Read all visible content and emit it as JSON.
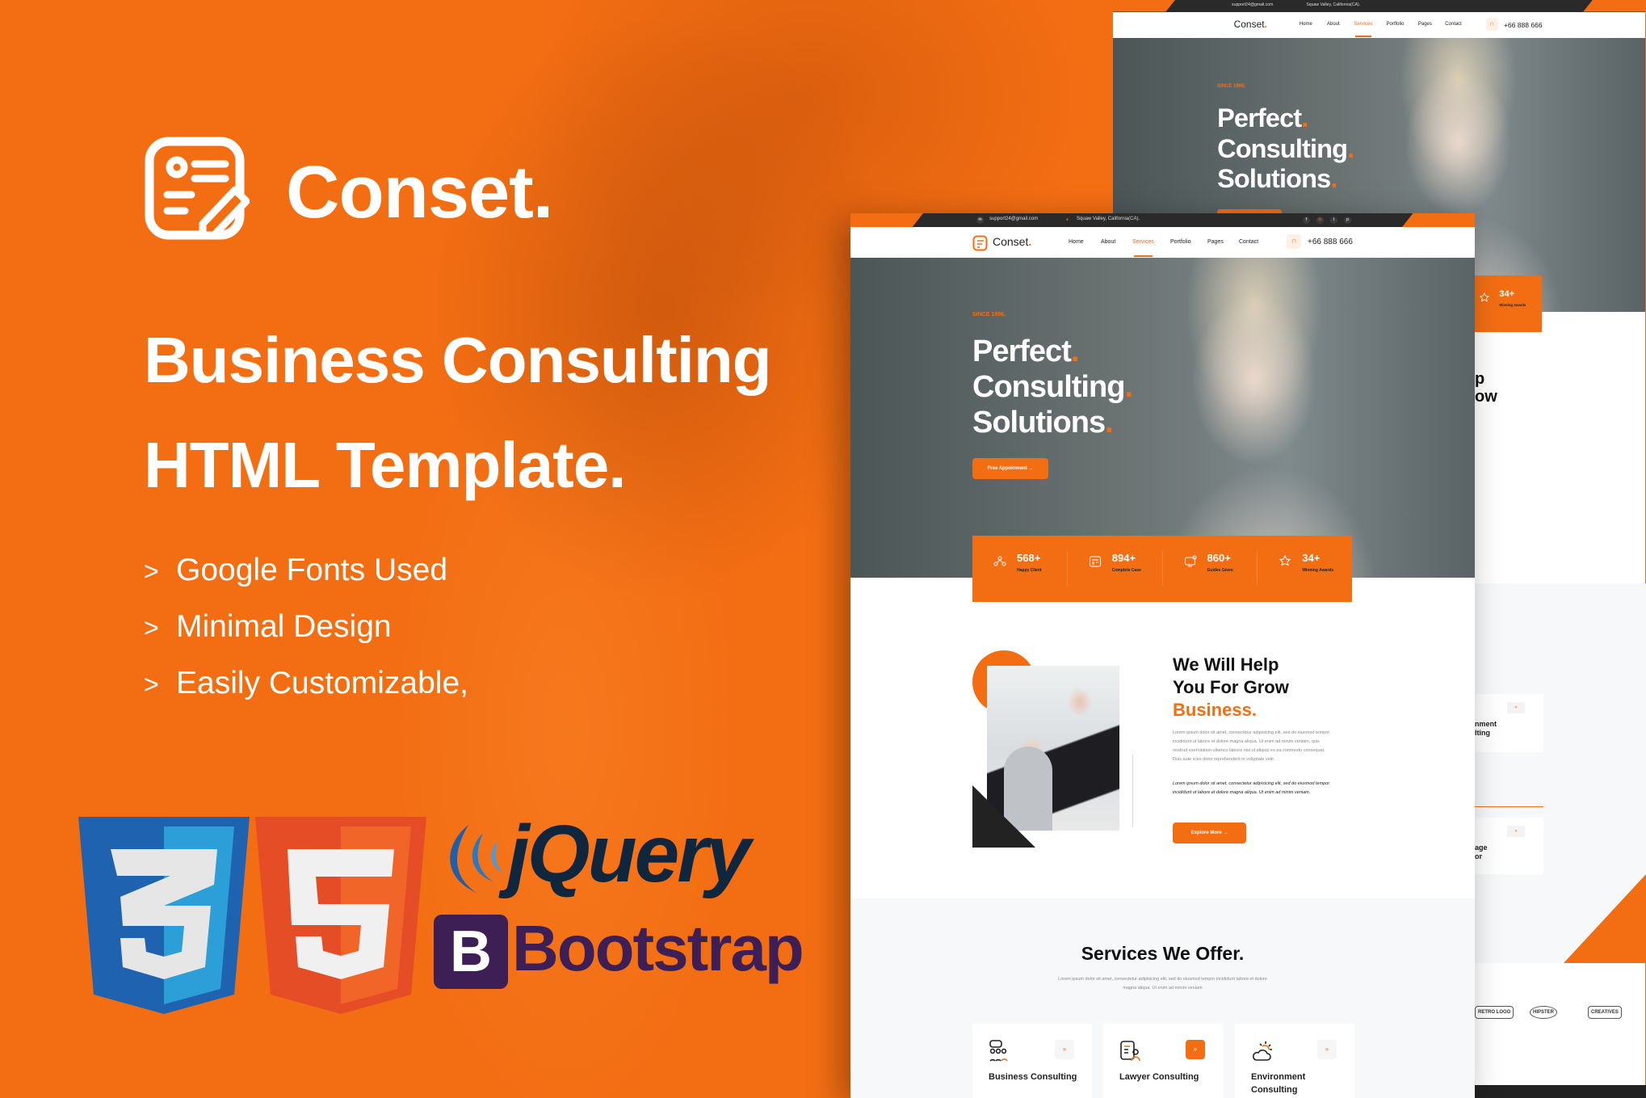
{
  "promo": {
    "brand": "Conset.",
    "headline_1": "Business Consulting",
    "headline_2": "HTML Template.",
    "features": [
      "Google Fonts Used",
      "Minimal Design",
      "Easily Customizable,"
    ],
    "bullet_marker": ">",
    "tech": {
      "css": "3",
      "html": "5",
      "jquery": "jQuery",
      "bootstrap_letter": "B",
      "bootstrap": "Bootstrap"
    }
  },
  "colors": {
    "accent": "#f36e13",
    "dark": "#2a2a2a",
    "css_blue": "#1f63b0",
    "html_orange": "#e44d26",
    "bootstrap_purple": "#563d7c"
  },
  "site": {
    "topbar": {
      "email": "support24@gmail.com",
      "location": "Squaw Valley, California(CA).",
      "social": [
        "f",
        "in",
        "t",
        "p"
      ]
    },
    "logo": "Conset",
    "logo_dot": ".",
    "nav": [
      "Home",
      "About",
      "Services",
      "Portfolio",
      "Pages",
      "Contact"
    ],
    "active_nav": "Services",
    "phone": "+66 888 666",
    "hero": {
      "since": "SINCE 1996.",
      "lines": [
        "Perfect",
        "Consulting",
        "Solutions"
      ],
      "dot": ".",
      "button": "Free Appoinment  →"
    },
    "stats": [
      {
        "value": "568+",
        "label": "Happy Client"
      },
      {
        "value": "894+",
        "label": "Complete Case"
      },
      {
        "value": "860+",
        "label": "Guides Given"
      },
      {
        "value": "34+",
        "label": "Winning Awards"
      }
    ],
    "about": {
      "h1": "We Will Help",
      "h2": "You For Grow",
      "h3": "Business.",
      "para": "Lorem ipsum dolor sit amet, consectetur adipisicing elit, sed do eiusmod tempor incididunt ut labore et dolore magna aliqua. Ut enim ad minim veniam, quis nostrud exercitation ullamco laboris nisi ut aliquip ex ea commodo consequat. Duis aute irure dolor reprehenderit in voluptate velit.",
      "para_italic": "Lorem ipsum dolor sit amet, consectetur adipisicing elit, sed do eiusmod tempor incididunt ut labore et dolore magna aliqua. Ut enim ad minim veniam.",
      "button": "Explore More   →"
    },
    "services": {
      "title": "Services We Offer.",
      "subtitle": "Lorem ipsum dolor sit amet, consectetur adipisicing elit, sed do eiusmod tempor incididunt labore et dolore magna aliqua. Ut enim ad minim veniam",
      "cards": [
        {
          "title": "Business Consulting",
          "icon": "team-chat-icon"
        },
        {
          "title": "Lawyer Consulting",
          "icon": "document-user-icon"
        },
        {
          "title": "Environment Consulting",
          "icon": "cloud-sun-icon"
        }
      ],
      "arrow": "»"
    }
  },
  "back_fragments": {
    "heading": [
      "p",
      "ow"
    ],
    "cards": [
      "nment",
      "lting",
      "age",
      "or"
    ],
    "clients": [
      "RETRO LOGO",
      "HIPSTER",
      "CREATIVES"
    ]
  }
}
